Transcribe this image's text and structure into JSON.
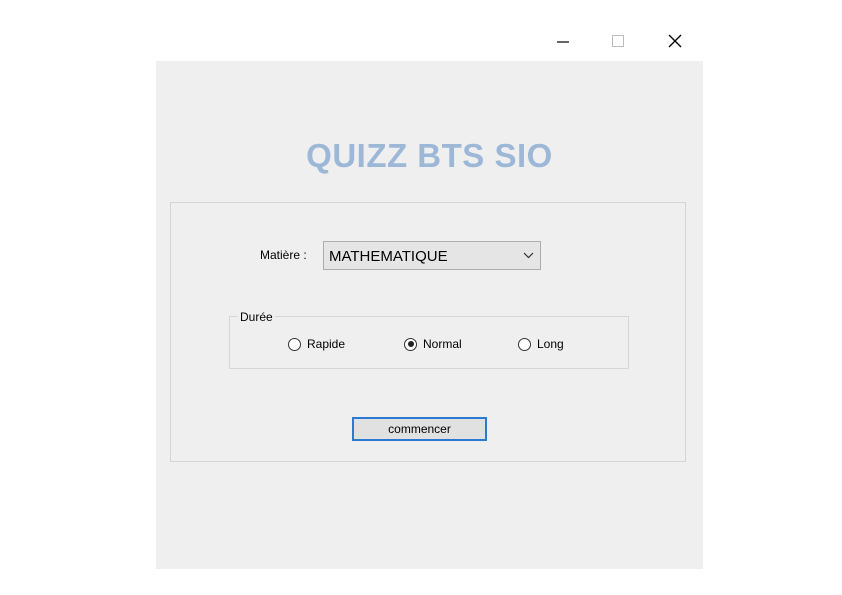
{
  "window": {
    "minimize_icon": "minimize-icon",
    "maximize_icon": "maximize-icon",
    "close_icon": "close-icon"
  },
  "app": {
    "title": "QUIZZ BTS SIO",
    "title_color": "#9db7d7",
    "accent": "#2b79d0"
  },
  "form": {
    "matiere_label": "Matière :",
    "matiere_value": "MATHEMATIQUE",
    "duree": {
      "legend": "Durée",
      "options": [
        {
          "label": "Rapide",
          "checked": false
        },
        {
          "label": "Normal",
          "checked": true
        },
        {
          "label": "Long",
          "checked": false
        }
      ]
    },
    "start_button": "commencer"
  }
}
